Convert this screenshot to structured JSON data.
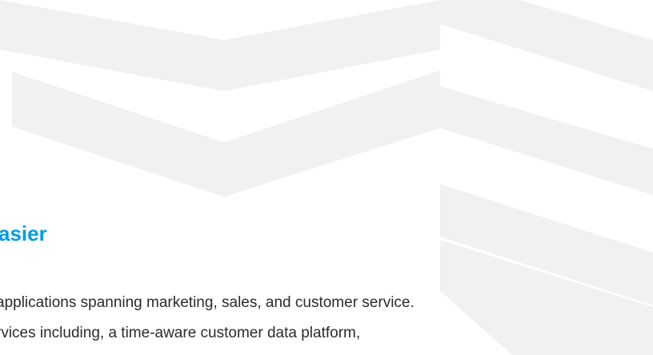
{
  "section": {
    "heading": "asier",
    "paragraph_lines": [
      "applications spanning marketing, sales, and customer service.",
      "rvices including, a time-aware customer data platform,"
    ]
  },
  "colors": {
    "heading": "#009ddc",
    "body_text": "#2b2b2b",
    "background": "#ffffff",
    "pattern": "#f1f1f1"
  }
}
